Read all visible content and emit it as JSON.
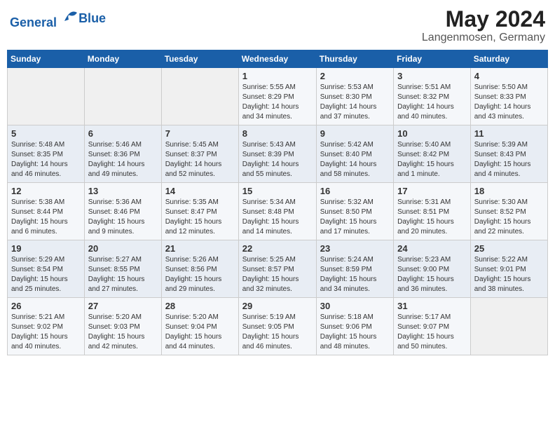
{
  "header": {
    "logo_line1": "General",
    "logo_line2": "Blue",
    "title": "May 2024",
    "subtitle": "Langenmosen, Germany"
  },
  "weekdays": [
    "Sunday",
    "Monday",
    "Tuesday",
    "Wednesday",
    "Thursday",
    "Friday",
    "Saturday"
  ],
  "weeks": [
    [
      {
        "day": "",
        "info": ""
      },
      {
        "day": "",
        "info": ""
      },
      {
        "day": "",
        "info": ""
      },
      {
        "day": "1",
        "info": "Sunrise: 5:55 AM\nSunset: 8:29 PM\nDaylight: 14 hours\nand 34 minutes."
      },
      {
        "day": "2",
        "info": "Sunrise: 5:53 AM\nSunset: 8:30 PM\nDaylight: 14 hours\nand 37 minutes."
      },
      {
        "day": "3",
        "info": "Sunrise: 5:51 AM\nSunset: 8:32 PM\nDaylight: 14 hours\nand 40 minutes."
      },
      {
        "day": "4",
        "info": "Sunrise: 5:50 AM\nSunset: 8:33 PM\nDaylight: 14 hours\nand 43 minutes."
      }
    ],
    [
      {
        "day": "5",
        "info": "Sunrise: 5:48 AM\nSunset: 8:35 PM\nDaylight: 14 hours\nand 46 minutes."
      },
      {
        "day": "6",
        "info": "Sunrise: 5:46 AM\nSunset: 8:36 PM\nDaylight: 14 hours\nand 49 minutes."
      },
      {
        "day": "7",
        "info": "Sunrise: 5:45 AM\nSunset: 8:37 PM\nDaylight: 14 hours\nand 52 minutes."
      },
      {
        "day": "8",
        "info": "Sunrise: 5:43 AM\nSunset: 8:39 PM\nDaylight: 14 hours\nand 55 minutes."
      },
      {
        "day": "9",
        "info": "Sunrise: 5:42 AM\nSunset: 8:40 PM\nDaylight: 14 hours\nand 58 minutes."
      },
      {
        "day": "10",
        "info": "Sunrise: 5:40 AM\nSunset: 8:42 PM\nDaylight: 15 hours\nand 1 minute."
      },
      {
        "day": "11",
        "info": "Sunrise: 5:39 AM\nSunset: 8:43 PM\nDaylight: 15 hours\nand 4 minutes."
      }
    ],
    [
      {
        "day": "12",
        "info": "Sunrise: 5:38 AM\nSunset: 8:44 PM\nDaylight: 15 hours\nand 6 minutes."
      },
      {
        "day": "13",
        "info": "Sunrise: 5:36 AM\nSunset: 8:46 PM\nDaylight: 15 hours\nand 9 minutes."
      },
      {
        "day": "14",
        "info": "Sunrise: 5:35 AM\nSunset: 8:47 PM\nDaylight: 15 hours\nand 12 minutes."
      },
      {
        "day": "15",
        "info": "Sunrise: 5:34 AM\nSunset: 8:48 PM\nDaylight: 15 hours\nand 14 minutes."
      },
      {
        "day": "16",
        "info": "Sunrise: 5:32 AM\nSunset: 8:50 PM\nDaylight: 15 hours\nand 17 minutes."
      },
      {
        "day": "17",
        "info": "Sunrise: 5:31 AM\nSunset: 8:51 PM\nDaylight: 15 hours\nand 20 minutes."
      },
      {
        "day": "18",
        "info": "Sunrise: 5:30 AM\nSunset: 8:52 PM\nDaylight: 15 hours\nand 22 minutes."
      }
    ],
    [
      {
        "day": "19",
        "info": "Sunrise: 5:29 AM\nSunset: 8:54 PM\nDaylight: 15 hours\nand 25 minutes."
      },
      {
        "day": "20",
        "info": "Sunrise: 5:27 AM\nSunset: 8:55 PM\nDaylight: 15 hours\nand 27 minutes."
      },
      {
        "day": "21",
        "info": "Sunrise: 5:26 AM\nSunset: 8:56 PM\nDaylight: 15 hours\nand 29 minutes."
      },
      {
        "day": "22",
        "info": "Sunrise: 5:25 AM\nSunset: 8:57 PM\nDaylight: 15 hours\nand 32 minutes."
      },
      {
        "day": "23",
        "info": "Sunrise: 5:24 AM\nSunset: 8:59 PM\nDaylight: 15 hours\nand 34 minutes."
      },
      {
        "day": "24",
        "info": "Sunrise: 5:23 AM\nSunset: 9:00 PM\nDaylight: 15 hours\nand 36 minutes."
      },
      {
        "day": "25",
        "info": "Sunrise: 5:22 AM\nSunset: 9:01 PM\nDaylight: 15 hours\nand 38 minutes."
      }
    ],
    [
      {
        "day": "26",
        "info": "Sunrise: 5:21 AM\nSunset: 9:02 PM\nDaylight: 15 hours\nand 40 minutes."
      },
      {
        "day": "27",
        "info": "Sunrise: 5:20 AM\nSunset: 9:03 PM\nDaylight: 15 hours\nand 42 minutes."
      },
      {
        "day": "28",
        "info": "Sunrise: 5:20 AM\nSunset: 9:04 PM\nDaylight: 15 hours\nand 44 minutes."
      },
      {
        "day": "29",
        "info": "Sunrise: 5:19 AM\nSunset: 9:05 PM\nDaylight: 15 hours\nand 46 minutes."
      },
      {
        "day": "30",
        "info": "Sunrise: 5:18 AM\nSunset: 9:06 PM\nDaylight: 15 hours\nand 48 minutes."
      },
      {
        "day": "31",
        "info": "Sunrise: 5:17 AM\nSunset: 9:07 PM\nDaylight: 15 hours\nand 50 minutes."
      },
      {
        "day": "",
        "info": ""
      }
    ]
  ]
}
